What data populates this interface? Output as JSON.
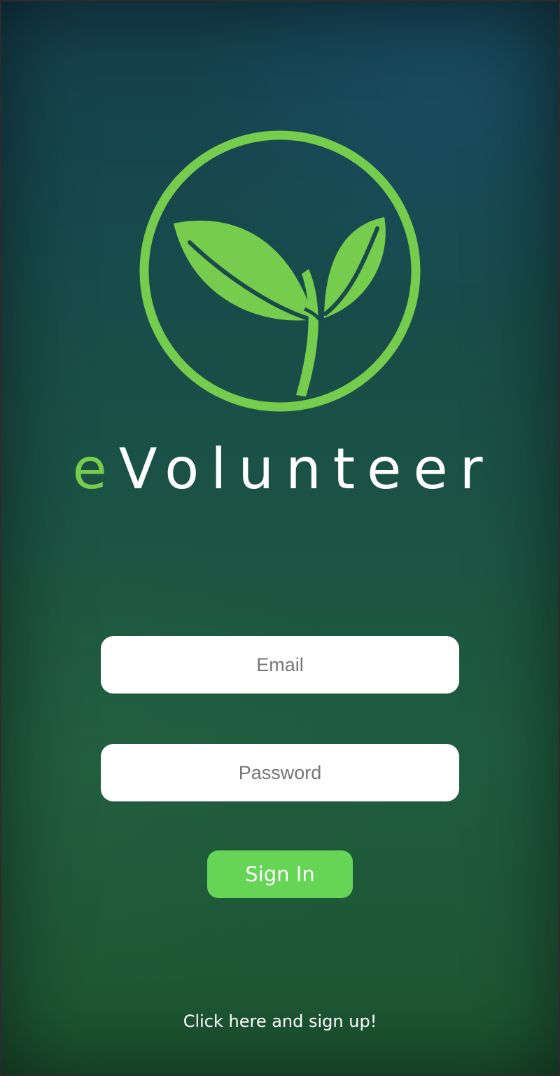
{
  "brand": {
    "prefix": "e",
    "name": "Volunteer",
    "accent_color": "#76cc4d"
  },
  "logo": {
    "icon": "sprout-leaf-icon",
    "color": "#76cc4d"
  },
  "form": {
    "email_placeholder": "Email",
    "password_placeholder": "Password",
    "signin_label": "Sign In",
    "signin_color": "#66d555"
  },
  "signup": {
    "label": "Click here and sign up!"
  }
}
